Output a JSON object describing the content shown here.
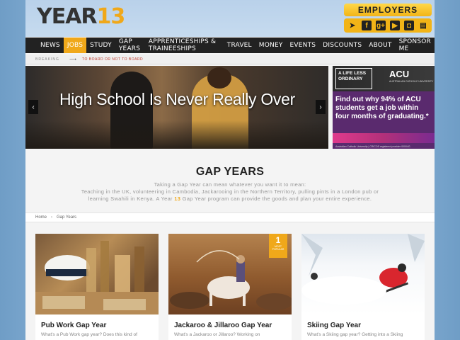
{
  "header": {
    "logo_year": "YEAR",
    "logo_num": "13",
    "employers_label": "EMPLOYERS",
    "social": [
      {
        "icon": "bird-icon",
        "glyph": "➤"
      },
      {
        "icon": "facebook-icon",
        "glyph": "f"
      },
      {
        "icon": "google-plus-icon",
        "glyph": "g+"
      },
      {
        "icon": "youtube-icon",
        "glyph": "▶"
      },
      {
        "icon": "instagram-icon",
        "glyph": "◘"
      },
      {
        "icon": "newsletter-icon",
        "glyph": "▤"
      }
    ]
  },
  "nav": {
    "items": [
      "NEWS",
      "JOBS",
      "STUDY",
      "GAP YEARS",
      "APPRENTICESHIPS & TRAINEESHIPS",
      "TRAVEL",
      "MONEY",
      "EVENTS",
      "DISCOUNTS",
      "ABOUT",
      "SPONSOR ME"
    ],
    "active": "JOBS"
  },
  "breaking": {
    "label": "BREAKING",
    "text": "TO BOARD OR NOT TO BOARD"
  },
  "hero": {
    "title": "High School Is Never Really Over",
    "prev": "‹",
    "next": "›"
  },
  "ad": {
    "badge": "A LIFE LESS ORDINARY",
    "brand": "ACU",
    "brand_sub": "AUSTRALIAN CATHOLIC UNIVERSITY",
    "message": "Find out why 94% of ACU students get a job within four months of graduating.*",
    "footer": "Australian Catholic University | CRICOS registered provider 00004G"
  },
  "intro": {
    "title": "GAP YEARS",
    "line1": "Taking a Gap Year can mean whatever you want it to mean:",
    "line2": "Teaching in the UK, volunteering in Cambodia, Jackarooing in the Northern Territory, pulling pints in a London pub or learning Swahili in Kenya. A Year",
    "highlight": "13",
    "line3": "Gap Year program can provide the goods and plan your entire experience."
  },
  "breadcrumb": {
    "home": "Home",
    "sep": "›",
    "current": "Gap Years"
  },
  "cards": [
    {
      "title": "Pub Work Gap Year",
      "text": "What's a Pub Work gap year? Does this kind of"
    },
    {
      "title": "Jackaroo & Jillaroo Gap Year",
      "text": "What's a Jackaroo or Jillaroo? Working on",
      "badge_num": "1",
      "badge_text": "MOST POPULAR"
    },
    {
      "title": "Skiing Gap Year",
      "text": "What's a Skiing gap year? Getting into a Skiing"
    }
  ],
  "colors": {
    "accent": "#f0a81a",
    "nav_bg": "#222222",
    "breaking_text": "#c0392b"
  }
}
